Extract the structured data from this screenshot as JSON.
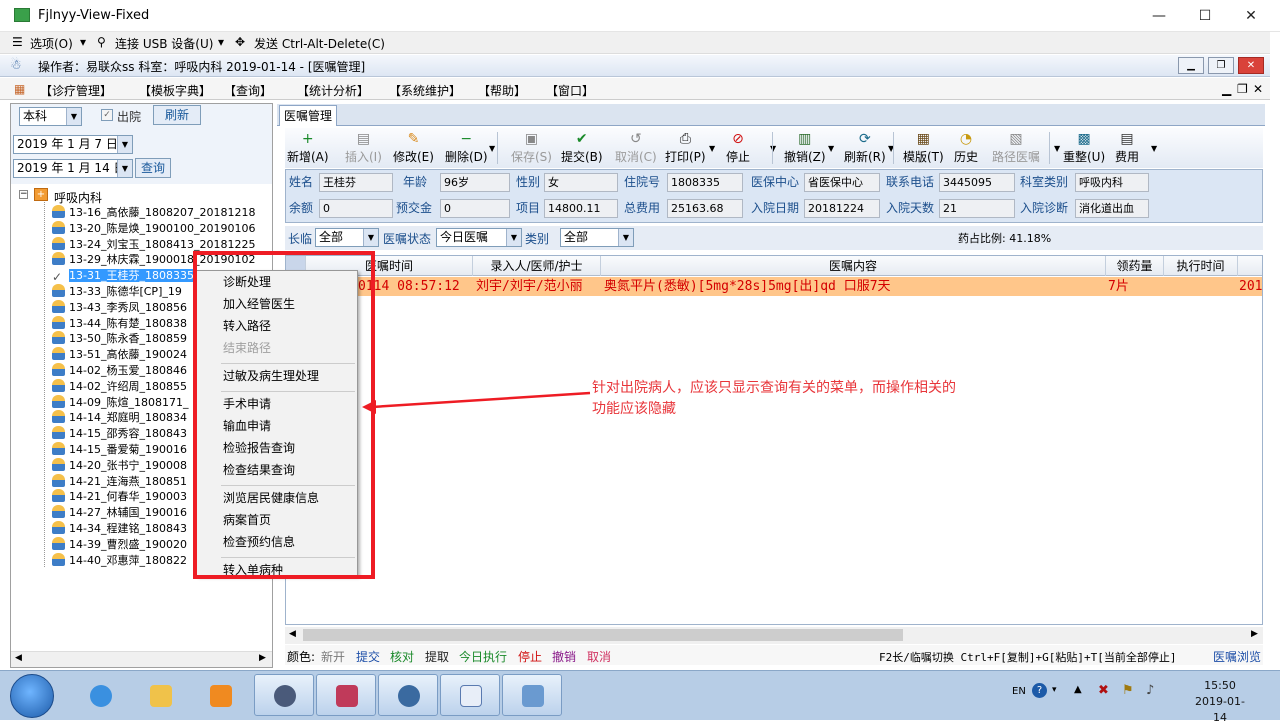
{
  "window": {
    "title": "Fjlnyy-View-Fixed",
    "minimize": "—",
    "maximize": "☐",
    "close": "✕"
  },
  "vmbar": {
    "options": "选项(O)",
    "usb": "连接 USB 设备(U)",
    "cad": "发送 Ctrl-Alt-Delete(C)"
  },
  "infobar": {
    "text": "操作者：易联众ss  科室：呼吸内科  2019-01-14 - [医嘱管理]"
  },
  "menu": [
    "【诊疗管理】",
    "【模板字典】",
    "【查询】",
    "【统计分析】",
    "【系统维护】",
    "【帮助】",
    "【窗口】"
  ],
  "left": {
    "dept_scope": "本科",
    "discharged_label": "出院",
    "refresh": "刷新",
    "date_from": "2019 年 1 月 7 日",
    "date_to": "2019 年 1 月 14 日",
    "query": "查询",
    "tree_root": "呼吸内科",
    "patients": [
      "13-16_高依藤_1808207_20181218",
      "13-20_陈是焕_1900100_20190106",
      "13-24_刘宝玉_1808413_20181225",
      "13-29_林庆霖_1900018_20190102",
      "13-31_王桂芬_1808335",
      "13-33_陈德华[CP]_19",
      "13-43_李秀凤_180856",
      "13-44_陈有楚_180838",
      "13-50_陈永香_180859",
      "13-51_高依藤_190024",
      "14-02_杨玉爱_180846",
      "14-02_许绍周_180855",
      "14-09_陈煊_1808171_",
      "14-14_郑庭明_180834",
      "14-15_邵秀容_180843",
      "14-15_番爱菊_190016",
      "14-20_张书宁_190008",
      "14-21_连海燕_180851",
      "14-21_何春华_190003",
      "14-27_林辅国_190016",
      "14-34_程建铭_180843",
      "14-39_曹烈盛_190020",
      "14-40_邓惠萍_180822"
    ]
  },
  "tab": "医嘱管理",
  "toolbar": [
    {
      "label": "新增(A)",
      "icon": "add-icon",
      "color": "#1a8a2a",
      "glyph": "+"
    },
    {
      "label": "插入(I)",
      "icon": "insert-icon",
      "color": "#888",
      "glyph": "▤"
    },
    {
      "label": "修改(E)",
      "icon": "edit-icon",
      "color": "#d98a1c",
      "glyph": "✎"
    },
    {
      "label": "删除(D)",
      "icon": "delete-icon",
      "color": "#1a8a2a",
      "glyph": "−"
    },
    {
      "label": "保存(S)",
      "icon": "save-icon",
      "color": "#888",
      "glyph": "▣"
    },
    {
      "label": "提交(B)",
      "icon": "submit-icon",
      "color": "#1a8a2a",
      "glyph": "✔"
    },
    {
      "label": "取消(C)",
      "icon": "undo-icon",
      "color": "#888",
      "glyph": "↺"
    },
    {
      "label": "打印(P)",
      "icon": "print-icon",
      "color": "#222",
      "glyph": "⎙"
    },
    {
      "label": "停止",
      "icon": "stop-icon",
      "color": "#d01010",
      "glyph": "⊘"
    },
    {
      "label": "撤销(Z)",
      "icon": "revoke-icon",
      "color": "#2a6a2a",
      "glyph": "▥"
    },
    {
      "label": "刷新(R)",
      "icon": "refresh-icon",
      "color": "#1a6a8a",
      "glyph": "⟳"
    },
    {
      "label": "模版(T)",
      "icon": "template-icon",
      "color": "#6a4a1a",
      "glyph": "▦"
    },
    {
      "label": "历史",
      "icon": "history-icon",
      "color": "#c89a10",
      "glyph": "◔"
    },
    {
      "label": "路径医嘱",
      "icon": "pathway-icon",
      "color": "#888",
      "glyph": "▧"
    },
    {
      "label": "重整(U)",
      "icon": "reorganize-icon",
      "color": "#1a6a8a",
      "glyph": "▩"
    },
    {
      "label": "费用",
      "icon": "fee-icon",
      "color": "#333",
      "glyph": "▤"
    }
  ],
  "patient": {
    "name_label": "姓名",
    "name": "王桂芬",
    "age_label": "年龄",
    "age": "96岁",
    "sex_label": "性别",
    "sex": "女",
    "admno_label": "住院号",
    "admno": "1808335",
    "insurance_label": "医保中心",
    "insurance": "省医保中心",
    "phone_label": "联系电话",
    "phone": "3445095",
    "dept_label": "科室类别",
    "dept": "呼吸内科",
    "balance_label": "余额",
    "balance": "0",
    "deposit_label": "预交金",
    "deposit": "0",
    "items_label": "项目",
    "items": "14800.11",
    "total_label": "总费用",
    "total": "25163.68",
    "admdate_label": "入院日期",
    "admdate": "20181224",
    "days_label": "入院天数",
    "days": "21",
    "diag_label": "入院诊断",
    "diag": "消化道出血"
  },
  "filters": {
    "term_label": "长临",
    "term": "全部",
    "status_label": "医嘱状态",
    "status": "今日医嘱",
    "type_label": "类别",
    "type": "全部",
    "drug_ratio": "药占比例: 41.18%"
  },
  "grid": {
    "columns": [
      "医嘱时间",
      "录入人/医师/护士",
      "医嘱内容",
      "领药量",
      "执行时间"
    ],
    "rows": [
      {
        "time": "0114 08:57:12",
        "staff": "刘宇/刘宇/范小丽",
        "content": "奥氮平片(悉敏)[5mg*28s]5mg[出]qd 口服7天",
        "qty": "7片",
        "exec": "201"
      }
    ]
  },
  "legend": {
    "prefix": "颜色:",
    "items": [
      {
        "text": "新开",
        "color": "#7a7a7a"
      },
      {
        "text": "提交",
        "color": "#1e4fa8"
      },
      {
        "text": "核对",
        "color": "#1a8a2a"
      },
      {
        "text": "提取",
        "color": "#222222"
      },
      {
        "text": "今日执行",
        "color": "#1a8a2a"
      },
      {
        "text": "停止",
        "color": "#d01010"
      },
      {
        "text": "撤销",
        "color": "#8a1a8a"
      },
      {
        "text": "取消",
        "color": "#d03060"
      }
    ],
    "shortcut": "F2长/临嘱切换 Ctrl+F[复制]+G[粘贴]+T[当前全部停止]",
    "browse": "医嘱浏览"
  },
  "context_menu": [
    {
      "label": "诊断处理",
      "enabled": true
    },
    {
      "label": "加入经管医生",
      "enabled": true
    },
    {
      "label": "转入路径",
      "enabled": true
    },
    {
      "label": "结束路径",
      "enabled": false
    },
    {
      "label": "过敏及病生理处理",
      "enabled": true
    },
    {
      "label": "手术申请",
      "enabled": true
    },
    {
      "label": "输血申请",
      "enabled": true
    },
    {
      "label": "检验报告查询",
      "enabled": true
    },
    {
      "label": "检查结果查询",
      "enabled": true
    },
    {
      "label": "浏览居民健康信息",
      "enabled": true
    },
    {
      "label": "病案首页",
      "enabled": true
    },
    {
      "label": "检查预约信息",
      "enabled": true
    },
    {
      "label": "转入单病种",
      "enabled": true
    }
  ],
  "annotation": {
    "line1": "针对出院病人，应该只显示查询有关的菜单，而操作相关的",
    "line2": "功能应该隐藏",
    "color": "#e8353a"
  },
  "taskbar": {
    "lang": "EN",
    "time": "15:50",
    "date": "2019-01-14"
  }
}
